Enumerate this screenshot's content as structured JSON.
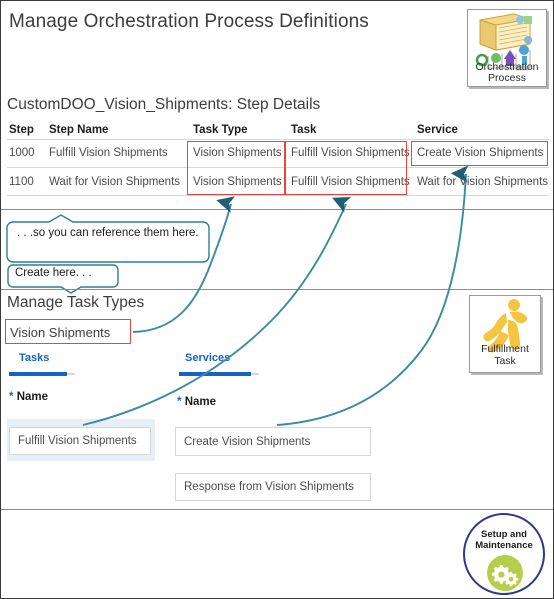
{
  "header": {
    "title": "Manage Orchestration Process Definitions",
    "icon_tile": {
      "name": "orchestration-process-icon",
      "caption_line1": "Orchestration",
      "caption_line2": "Process"
    }
  },
  "step_details": {
    "title": "CustomDOO_Vision_Shipments: Step Details",
    "columns": [
      "Step",
      "Step Name",
      "Task Type",
      "Task",
      "Service"
    ],
    "rows": [
      {
        "step": "1000",
        "step_name": "Fulfill Vision Shipments",
        "task_type": "Vision Shipments",
        "task": "Fulfill Vision Shipments",
        "service": "Create Vision Shipments"
      },
      {
        "step": "1100",
        "step_name": "Wait for Vision Shipments",
        "task_type": "Vision Shipments",
        "task": "Fulfill Vision Shipments",
        "service": "Wait for Vision Shipments"
      }
    ]
  },
  "callouts": {
    "reference": ". . .so you can reference  them here.",
    "create": "Create here. . ."
  },
  "task_types": {
    "title": "Manage Task Types",
    "task_type_name": "Vision Shipments",
    "tabs": [
      {
        "label": "Tasks"
      },
      {
        "label": "Services"
      }
    ],
    "tasks_panel": {
      "name_label": "Name",
      "required_marker": "*",
      "value": "Fulfill Vision Shipments"
    },
    "services_panel": {
      "name_label": "Name",
      "required_marker": "*",
      "values": [
        "Create Vision Shipments",
        "Response from Vision Shipments"
      ]
    },
    "icon_tile": {
      "name": "fulfillment-task-icon",
      "caption_line1": "Fulfillment",
      "caption_line2": "Task"
    }
  },
  "footer": {
    "setup_badge": {
      "line1": "Setup and",
      "line2": "Maintenance",
      "icon": "gears-icon"
    }
  },
  "colors": {
    "highlight_red": "#e8453c",
    "arrow_teal": "#2b7f95",
    "tab_blue": "#1565c0",
    "badge_border_blue": "#2b3a8f",
    "gear_green": "#b5cf4a",
    "icon_gold": "#f5c542"
  }
}
